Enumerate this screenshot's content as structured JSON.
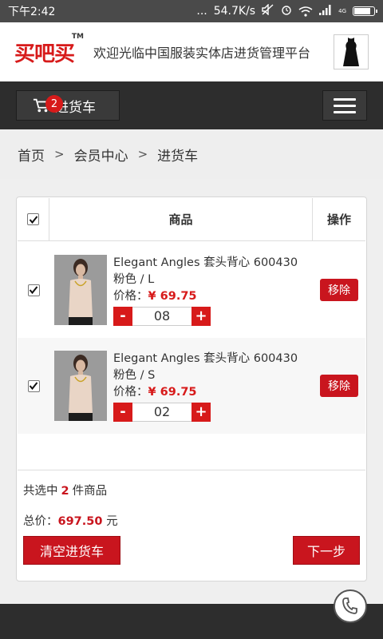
{
  "status_bar": {
    "time": "下午2:42",
    "dots": "...",
    "speed": "54.7K/s",
    "network": "4G",
    "battery_level": 0.85
  },
  "header": {
    "logo_text": "买吧买",
    "logo_tm": "TM",
    "tagline": "欢迎光临中国服装实体店进货管理平台"
  },
  "nav": {
    "cart_label": "进货车",
    "cart_count": "2"
  },
  "breadcrumb": {
    "items": [
      "首页",
      "会员中心",
      "进货车"
    ],
    "separator": ">"
  },
  "table": {
    "col_product": "商品",
    "col_action": "操作"
  },
  "items": [
    {
      "title": "Elegant Angles 套头背心 600430",
      "variant": "粉色 / L",
      "price_label": "价格：",
      "price": "¥ 69.75",
      "qty": "08",
      "minus": "-",
      "plus": "+",
      "remove": "移除"
    },
    {
      "title": "Elegant Angles 套头背心 600430",
      "variant": "粉色 / S",
      "price_label": "价格：",
      "price": "¥ 69.75",
      "qty": "02",
      "minus": "-",
      "plus": "+",
      "remove": "移除"
    }
  ],
  "summary": {
    "selected_prefix": "共选中",
    "selected_count": "2",
    "selected_suffix": "件商品",
    "total_label": "总价：",
    "total_value": "697.50",
    "total_unit": "元"
  },
  "actions": {
    "clear": "清空进货车",
    "next": "下一步"
  },
  "colors": {
    "accent": "#c9151e",
    "nav_bg": "#2d2d2d"
  }
}
